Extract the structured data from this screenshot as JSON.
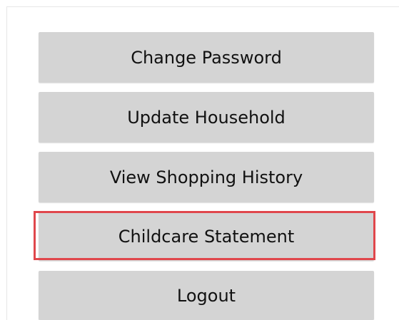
{
  "menu": {
    "buttons": [
      {
        "id": "change-password",
        "label": "Change Password"
      },
      {
        "id": "update-household",
        "label": "Update Household"
      },
      {
        "id": "view-shopping-history",
        "label": "View Shopping History"
      },
      {
        "id": "childcare-statement",
        "label": "Childcare Statement",
        "highlighted": true
      },
      {
        "id": "logout",
        "label": "Logout"
      }
    ]
  },
  "colors": {
    "button_bg": "#d4d4d4",
    "highlight_border": "#e0474c",
    "text": "#111111"
  }
}
